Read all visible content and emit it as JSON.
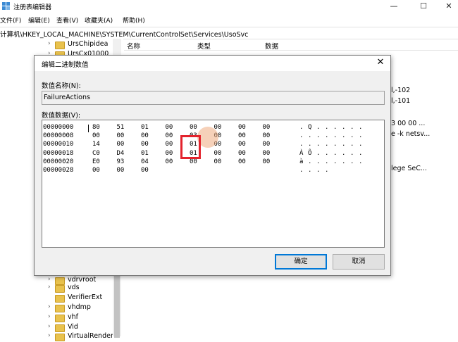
{
  "window": {
    "title": "注册表编辑器",
    "controls": {
      "minimize": "—",
      "maximize": "☐",
      "close": "✕"
    }
  },
  "menu": [
    "文件(F)",
    "编辑(E)",
    "查看(V)",
    "收藏夹(A)",
    "帮助(H)"
  ],
  "address": "计算机\\HKEY_LOCAL_MACHINE\\SYSTEM\\CurrentControlSet\\Services\\UsoSvc",
  "tree": {
    "top_items": [
      "UrsChipidea",
      "UrsCx01000"
    ],
    "bottom_items": [
      "vdrvroot",
      "vds",
      "VerifierExt",
      "vhdmp",
      "vhf",
      "Vid",
      "VirtualRender"
    ]
  },
  "list": {
    "columns": [
      "名称",
      "类型",
      "数据"
    ],
    "data_fragments": [
      "l,-102",
      "l,-101",
      "3 00 00 ...",
      "e -k netsv...",
      "lege SeC..."
    ]
  },
  "dialog": {
    "title": "编辑二进制数值",
    "close": "✕",
    "name_label": "数值名称(N):",
    "name_value": "FailureActions",
    "data_label": "数值数据(V):",
    "rows": [
      {
        "offset": "00000000",
        "bytes": [
          "80",
          "51",
          "01",
          "00",
          "00",
          "00",
          "00",
          "00"
        ],
        "ascii": [
          ".",
          "Q",
          ".",
          ".",
          ".",
          ".",
          ".",
          "."
        ]
      },
      {
        "offset": "00000008",
        "bytes": [
          "00",
          "00",
          "00",
          "00",
          "03",
          "00",
          "00",
          "00"
        ],
        "ascii": [
          ".",
          ".",
          ".",
          ".",
          ".",
          ".",
          ".",
          "."
        ]
      },
      {
        "offset": "00000010",
        "bytes": [
          "14",
          "00",
          "00",
          "00",
          "01",
          "00",
          "00",
          "00"
        ],
        "ascii": [
          ".",
          ".",
          ".",
          ".",
          ".",
          ".",
          ".",
          "."
        ]
      },
      {
        "offset": "00000018",
        "bytes": [
          "C0",
          "D4",
          "01",
          "00",
          "01",
          "00",
          "00",
          "00"
        ],
        "ascii": [
          "À",
          "Ô",
          ".",
          ".",
          ".",
          ".",
          ".",
          "."
        ]
      },
      {
        "offset": "00000020",
        "bytes": [
          "E0",
          "93",
          "04",
          "00",
          "00",
          "00",
          "00",
          "00"
        ],
        "ascii": [
          "à",
          ".",
          ".",
          ".",
          ".",
          ".",
          ".",
          "."
        ]
      },
      {
        "offset": "00000028",
        "bytes": [
          "00",
          "00",
          "00",
          "",
          "",
          "",
          "",
          ""
        ],
        "ascii": [
          ".",
          ".",
          ".",
          ".",
          "",
          "",
          "",
          ""
        ]
      }
    ],
    "ok_button": "确定",
    "cancel_button": "取消"
  },
  "colors": {
    "highlight": "#e3232d",
    "folder": "#e9c24d",
    "accent": "#0078d7"
  }
}
